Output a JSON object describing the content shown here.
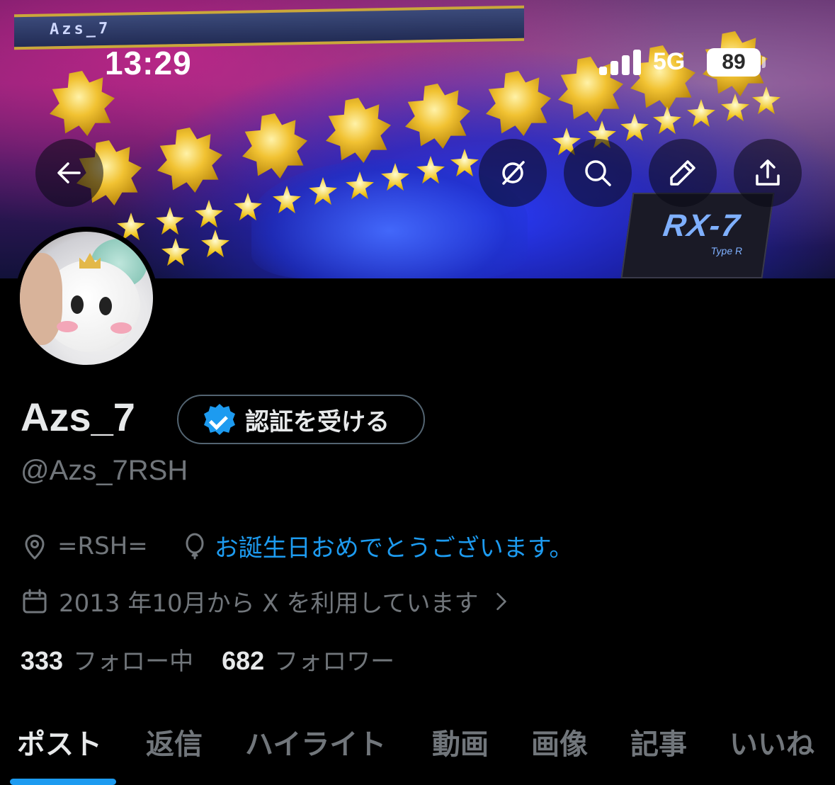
{
  "status_bar": {
    "time": "13:29",
    "network": "5G",
    "battery": "89"
  },
  "banner": {
    "top_text": "Azs_7",
    "rx7_title": "RX-7",
    "rx7_subtitle": "Type R"
  },
  "toolbar": {
    "back_icon": "arrow-left-icon",
    "grok_icon": "grok-icon",
    "search_icon": "search-icon",
    "edit_icon": "pencil-icon",
    "share_icon": "share-icon"
  },
  "profile": {
    "display_name": "Azs_7",
    "verify_label": "認証を受ける",
    "handle": "@Azs_7RSH",
    "location": "=RSH=",
    "birthday_text": "お誕生日おめでとうございます。",
    "joined": "2013 年10月から X を利用しています",
    "following_count": "333",
    "following_label": "フォロー中",
    "followers_count": "682",
    "followers_label": "フォロワー"
  },
  "tabs": [
    {
      "label": "ポスト",
      "active": true
    },
    {
      "label": "返信",
      "active": false
    },
    {
      "label": "ハイライト",
      "active": false
    },
    {
      "label": "動画",
      "active": false
    },
    {
      "label": "画像",
      "active": false
    },
    {
      "label": "記事",
      "active": false
    },
    {
      "label": "いいね",
      "active": false
    }
  ],
  "colors": {
    "accent": "#1d9bf0",
    "background": "#000000",
    "secondary_text": "#71767b",
    "primary_text": "#e7e9ea"
  }
}
